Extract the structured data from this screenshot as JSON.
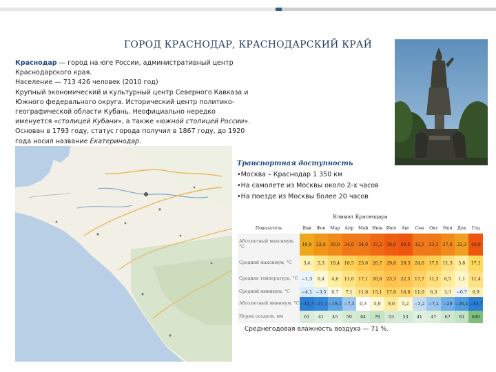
{
  "title": "ГОРОД КРАСНОДАР, КРАСНОДАРСКИЙ КРАЙ",
  "intro": {
    "name": "Краснодар",
    "lead": " — город на юге России, административный центр Краснодарского края.",
    "population": "Население — 713 426 человек (2010 год)",
    "center_a": "Крупный экономический и культурный центр Северного Кавказа и Южного федерального округа. Исторический центр политико-географической области Кубань. Неофициально нередко именуется «",
    "center_it1": "столицей Кубани",
    "center_b": "», а также «",
    "center_it2": "южной столицей России",
    "center_c": "».",
    "founded_a": "Основан в 1793 году, статус города получил в 1867 году, до 1920 года носил название ",
    "founded_it": "Екатеринодар",
    "founded_c": "."
  },
  "transport": {
    "heading": "Транспортная доступность",
    "items": [
      "•Москва – Краснодар 1 350 км",
      "•На самолете из Москвы около 2-х часов",
      "•На поезде из Москвы более 20 часов"
    ]
  },
  "climate": {
    "title": "Климат Краснодара",
    "header_label": "Показатель",
    "months": [
      "Янв",
      "Фев",
      "Мар",
      "Апр",
      "Май",
      "Июн",
      "Июл",
      "Авг",
      "Сен",
      "Окт",
      "Ноя",
      "Дек",
      "Год"
    ],
    "rows": [
      {
        "label": "Абсолютный максимум, °C",
        "values": [
          "18,9",
          "22,6",
          "29,0",
          "34,0",
          "34,0",
          "37,2",
          "39,0",
          "40,0",
          "32,5",
          "33,3",
          "27,4",
          "22,3",
          "40,0"
        ]
      },
      {
        "label": "Средний максимум, °C",
        "values": [
          "3,4",
          "5,3",
          "10,4",
          "18,5",
          "23,6",
          "26,7",
          "29,6",
          "29,3",
          "24,6",
          "17,5",
          "11,3",
          "5,8",
          "17,1"
        ]
      },
      {
        "label": "Средняя температура, °C",
        "values": [
          "−1,3",
          "0,4",
          "4,6",
          "11,0",
          "17,1",
          "20,8",
          "23,3",
          "22,5",
          "17,7",
          "11,3",
          "6,5",
          "1,1",
          "11,4"
        ]
      },
      {
        "label": "Средний минимум, °C",
        "values": [
          "−4,1",
          "−3,5",
          "0,7",
          "7,1",
          "11,8",
          "15,1",
          "17,6",
          "16,6",
          "11,0",
          "6,3",
          "3,3",
          "−0,7",
          "6,9"
        ]
      },
      {
        "label": "Абсолютный минимум, °C",
        "values": [
          "−33,7",
          "−31,1",
          "−18,1",
          "−7,3",
          "0,3",
          "5,0",
          "9,0",
          "5,2",
          "−3,2",
          "−7,2",
          "−20",
          "−26,1",
          "−33,7"
        ]
      },
      {
        "label": "Норма осадков, мм",
        "values": [
          "61",
          "41",
          "45",
          "59",
          "64",
          "78",
          "53",
          "53",
          "41",
          "47",
          "67",
          "81",
          "690"
        ]
      }
    ],
    "colors": [
      [
        "#f0a81b",
        "#f0961a",
        "#f08b1a",
        "#f0781a",
        "#f07818",
        "#f06a15",
        "#f05d12",
        "#f05510",
        "#f07a1a",
        "#f07818",
        "#f08a1a",
        "#f0a020",
        "#f05510"
      ],
      [
        "#fff3b4",
        "#ffe68f",
        "#ffd96b",
        "#ffd35a",
        "#ffc84a",
        "#ffbf42",
        "#ffb63a",
        "#ffb83c",
        "#ffc64a",
        "#ffcf55",
        "#ffdf7d",
        "#ffee9e",
        "#ffd85e"
      ],
      [
        "#eaf4fb",
        "#fff8d2",
        "#ffee9f",
        "#ffe282",
        "#ffd669",
        "#ffcc5c",
        "#ffc24f",
        "#ffc654",
        "#ffd266",
        "#ffde7b",
        "#ffeb9c",
        "#fff6c6",
        "#ffe182"
      ],
      [
        "#d7eaf7",
        "#dcedf8",
        "#fffbe6",
        "#fff1ad",
        "#ffe48b",
        "#ffdb74",
        "#ffd262",
        "#ffd56a",
        "#ffe48c",
        "#ffedaa",
        "#fff4c0",
        "#e9f3fb",
        "#fff0b3"
      ],
      [
        "#2b7fd6",
        "#3488da",
        "#5fa4e2",
        "#9cc6ee",
        "#ffffff",
        "#fff6cf",
        "#ffea9c",
        "#fff6cf",
        "#c2dcf4",
        "#9cc6ee",
        "#70aee6",
        "#4f9be0",
        "#2b7fd6"
      ],
      [
        "#d9ecd8",
        "#dff0df",
        "#def0de",
        "#d6ebd5",
        "#d2e9d1",
        "#c6e3c5",
        "#d6ebd5",
        "#d6ebd5",
        "#dff0df",
        "#dbeeda",
        "#cfe7ce",
        "#c4e2c3",
        "#7fbf7d"
      ]
    ]
  },
  "humidity": "Среднегодовая влажность воздуха — 71 %."
}
